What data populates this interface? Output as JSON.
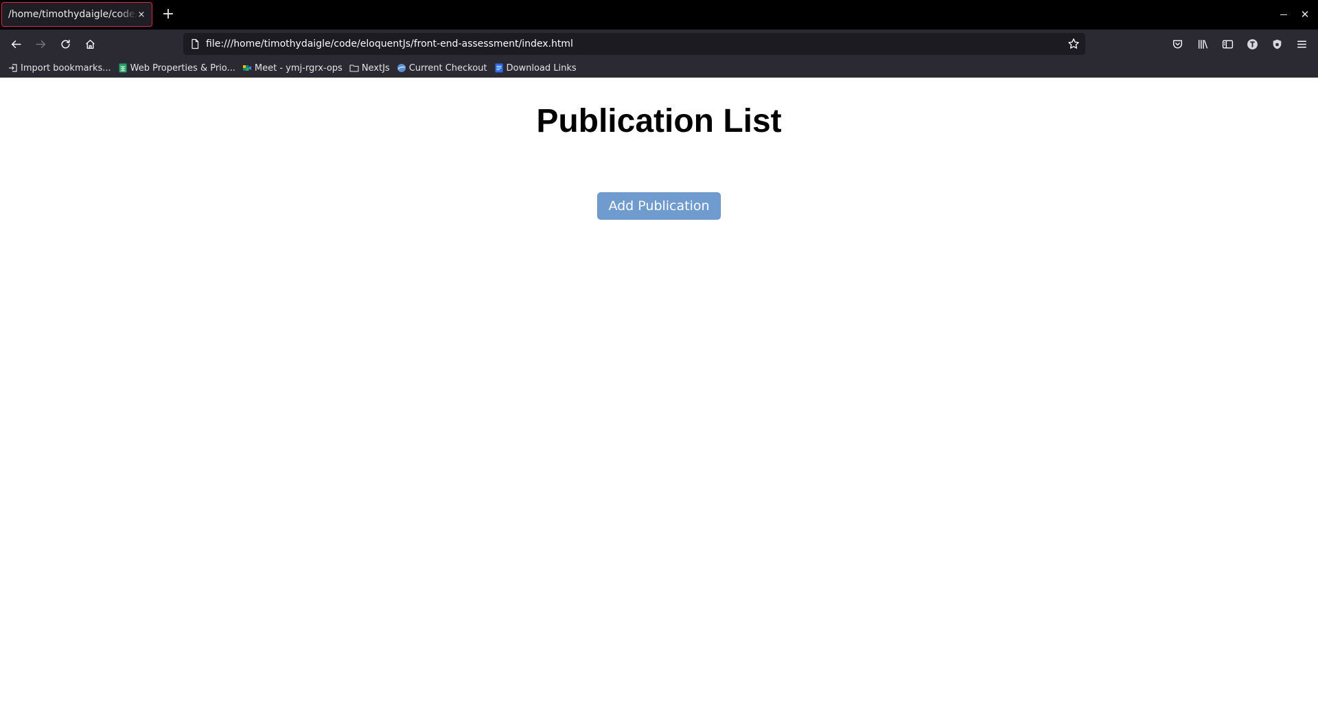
{
  "browser": {
    "tab": {
      "title": "/home/timothydaigle/code/eloquentJs/front-end-assessment/index.html",
      "close_glyph": "×"
    },
    "new_tab_glyph": "+",
    "window": {
      "close_glyph": "✕"
    },
    "url": "file:///home/timothydaigle/code/eloquentJs/front-end-assessment/index.html",
    "bookmarks": [
      {
        "label": "Import bookmarks...",
        "icon": "import-icon",
        "color": "#e4e4e4"
      },
      {
        "label": "Web Properties & Prio...",
        "icon": "sheets-icon",
        "color": "#1ea362"
      },
      {
        "label": "Meet - ymj-rgrx-ops",
        "icon": "meet-icon",
        "color": "#00897b"
      },
      {
        "label": "NextJs",
        "icon": "folder-icon",
        "color": "#e4e4e4"
      },
      {
        "label": "Current Checkout",
        "icon": "globe-icon",
        "color": "#5b8fd6"
      },
      {
        "label": "Download Links",
        "icon": "docs-icon",
        "color": "#2b6de8"
      }
    ],
    "colors": {
      "titlebar": "#000000",
      "toolbar": "#2b2a33",
      "urlbar": "#1c1b22",
      "active_tab_border": "#e0254a"
    }
  },
  "page": {
    "title": "Publication List",
    "add_button_label": "Add Publication",
    "add_button_color": "#6f9bcf"
  }
}
